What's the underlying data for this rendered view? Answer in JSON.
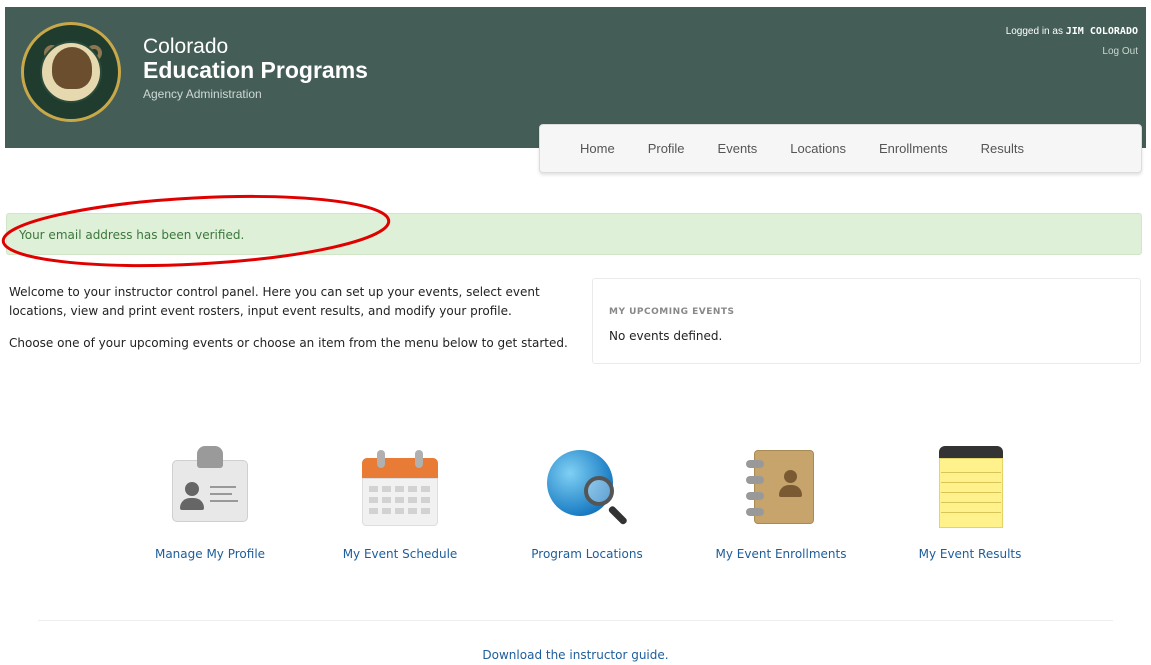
{
  "header": {
    "title_small": "Colorado",
    "title_big": "Education Programs",
    "subtitle": "Agency Administration",
    "logo_text": "COLORADO PARKS & WILDLIFE",
    "login_prefix": "Logged in as",
    "user_name": "JIM COLORADO",
    "logout_label": "Log Out",
    "background_color": "#445e57"
  },
  "nav": {
    "items": [
      {
        "label": "Home"
      },
      {
        "label": "Profile"
      },
      {
        "label": "Events"
      },
      {
        "label": "Locations"
      },
      {
        "label": "Enrollments"
      },
      {
        "label": "Results"
      }
    ]
  },
  "alert": {
    "message": "Your email address has been verified.",
    "background_color": "#dff0d8",
    "text_color": "#3c763d",
    "annotation_color": "#e00000"
  },
  "intro": {
    "paragraph_1": "Welcome to your instructor control panel. Here you can set up your events, select event locations, view and print event rosters, input event results, and modify your profile.",
    "paragraph_2": "Choose one of your upcoming events or choose an item from the menu below to get started."
  },
  "upcoming": {
    "heading": "MY UPCOMING EVENTS",
    "empty_text": "No events defined."
  },
  "tiles": [
    {
      "label": "Manage My Profile",
      "icon": "id-card-icon"
    },
    {
      "label": "My Event Schedule",
      "icon": "calendar-icon"
    },
    {
      "label": "Program Locations",
      "icon": "globe-magnifier-icon"
    },
    {
      "label": "My Event Enrollments",
      "icon": "address-book-icon"
    },
    {
      "label": "My Event Results",
      "icon": "notepad-icon"
    }
  ],
  "footer": {
    "guide_link": "Download the instructor guide."
  },
  "link_color": "#1d5d9b"
}
